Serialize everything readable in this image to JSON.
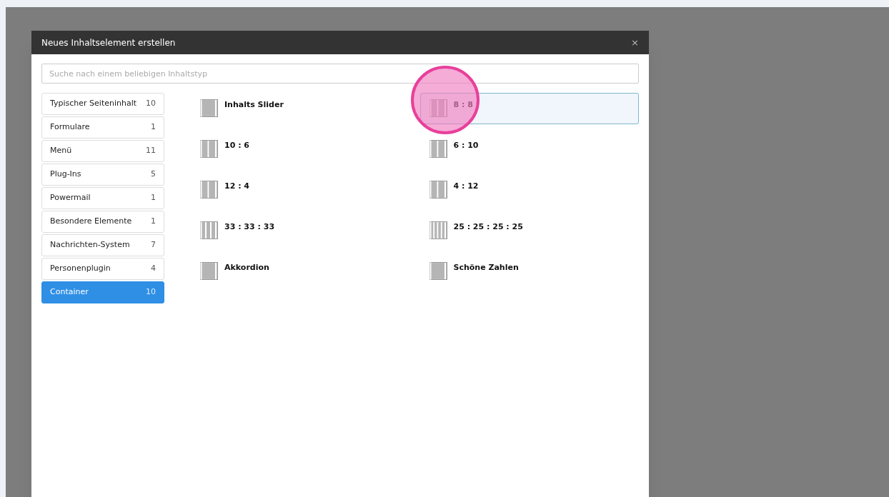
{
  "dialog": {
    "title": "Neues Inhaltselement erstellen",
    "close": "×"
  },
  "search": {
    "placeholder": "Suche nach einem beliebigen Inhaltstyp"
  },
  "categories": [
    {
      "label": "Typischer Seiteninhalt",
      "count": "10",
      "selected": false
    },
    {
      "label": "Formulare",
      "count": "1",
      "selected": false
    },
    {
      "label": "Menü",
      "count": "11",
      "selected": false
    },
    {
      "label": "Plug-Ins",
      "count": "5",
      "selected": false
    },
    {
      "label": "Powermail",
      "count": "1",
      "selected": false
    },
    {
      "label": "Besondere Elemente",
      "count": "1",
      "selected": false
    },
    {
      "label": "Nachrichten-System",
      "count": "7",
      "selected": false
    },
    {
      "label": "Personenplugin",
      "count": "4",
      "selected": false
    },
    {
      "label": "Container",
      "count": "10",
      "selected": true
    }
  ],
  "elements": [
    {
      "label": "Inhalts Slider",
      "kind": "one",
      "selected": false
    },
    {
      "label": "8 : 8",
      "kind": "two",
      "selected": true
    },
    {
      "label": "10 : 6",
      "kind": "two",
      "selected": false
    },
    {
      "label": "6 : 10",
      "kind": "two",
      "selected": false
    },
    {
      "label": "12 : 4",
      "kind": "two",
      "selected": false
    },
    {
      "label": "4 : 12",
      "kind": "two",
      "selected": false
    },
    {
      "label": "33 : 33 : 33",
      "kind": "three",
      "selected": false
    },
    {
      "label": "25 : 25 : 25 : 25",
      "kind": "four",
      "selected": false
    },
    {
      "label": "Akkordion",
      "kind": "one",
      "selected": false
    },
    {
      "label": "Schöne Zahlen",
      "kind": "one",
      "selected": false
    }
  ]
}
